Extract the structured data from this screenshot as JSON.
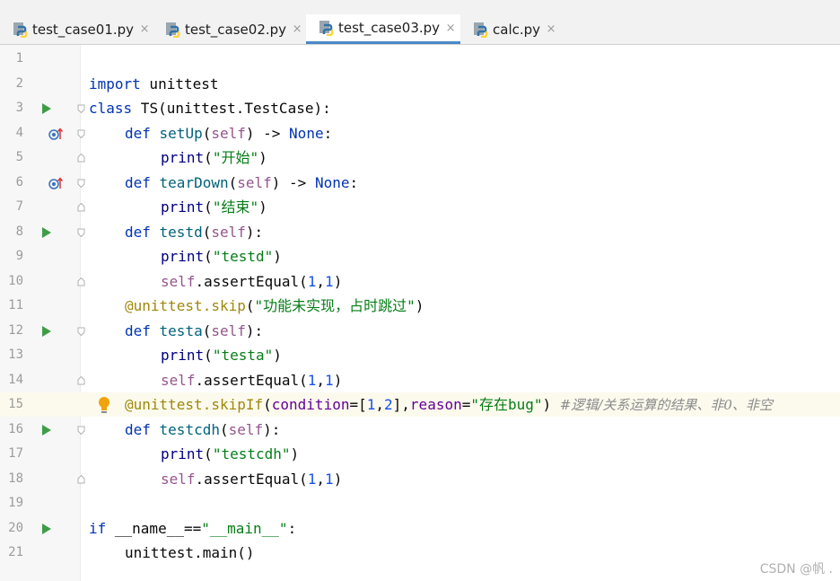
{
  "tabs": [
    {
      "label": "test_case01.py",
      "active": false,
      "icon": "python-file-icon"
    },
    {
      "label": "test_case02.py",
      "active": false,
      "icon": "python-file-icon"
    },
    {
      "label": "test_case03.py",
      "active": true,
      "icon": "python-file-icon"
    },
    {
      "label": "calc.py",
      "active": false,
      "icon": "python-file-icon"
    }
  ],
  "close_glyph": "×",
  "line_numbers": [
    "1",
    "2",
    "3",
    "4",
    "5",
    "6",
    "7",
    "8",
    "9",
    "10",
    "11",
    "12",
    "13",
    "14",
    "15",
    "16",
    "17",
    "18",
    "19",
    "20",
    "21"
  ],
  "code": {
    "l2": {
      "kw": "import",
      "rest": " unittest"
    },
    "l3": {
      "kw": "class",
      "rest": " TS(unittest.TestCase):"
    },
    "l4": {
      "kw": "def",
      "name": " setUp",
      "open": "(",
      "self": "self",
      "mid": ") -> ",
      "none": "None",
      "end": ":"
    },
    "l5": {
      "fn": "print",
      "open": "(",
      "str": "\"开始\"",
      "close": ")"
    },
    "l6": {
      "kw": "def",
      "name": " tearDown",
      "open": "(",
      "self": "self",
      "mid": ") -> ",
      "none": "None",
      "end": ":"
    },
    "l7": {
      "fn": "print",
      "open": "(",
      "str": "\"结束\"",
      "close": ")"
    },
    "l8": {
      "kw": "def",
      "name": " testd",
      "open": "(",
      "self": "self",
      "end": "):"
    },
    "l9": {
      "fn": "print",
      "open": "(",
      "str": "\"testd\"",
      "close": ")"
    },
    "l10": {
      "self": "self",
      "call": ".assertEqual(",
      "n1": "1",
      "comma": ",",
      "n2": "1",
      "close": ")"
    },
    "l11": {
      "deco": "@unittest.skip",
      "open": "(",
      "str": "\"功能未实现，占时跳过\"",
      "close": ")"
    },
    "l12": {
      "kw": "def",
      "name": " testa",
      "open": "(",
      "self": "self",
      "end": "):"
    },
    "l13": {
      "fn": "print",
      "open": "(",
      "str": "\"testa\"",
      "close": ")"
    },
    "l14": {
      "self": "self",
      "call": ".assertEqual(",
      "n1": "1",
      "comma": ",",
      "n2": "1",
      "close": ")"
    },
    "l15": {
      "deco": "@unittest.skipIf",
      "open": "(",
      "p1": "condition",
      "eq1": "=[",
      "n1": "1",
      "c": ",",
      "n2": "2",
      "mid": "],",
      "p2": "reason",
      "eq2": "=",
      "str": "\"存在bug\"",
      "close": ")",
      "comment": "  #逻辑/关系运算的结果、非0、非空"
    },
    "l16": {
      "kw": "def",
      "name": " testcdh",
      "open": "(",
      "self": "self",
      "end": "):"
    },
    "l17": {
      "fn": "print",
      "open": "(",
      "str": "\"testcdh\"",
      "close": ")"
    },
    "l18": {
      "self": "self",
      "call": ".assertEqual(",
      "n1": "1",
      "comma": ",",
      "n2": "1",
      "close": ")"
    },
    "l20": {
      "kw": "if",
      "mid": " __name__==",
      "str": "\"__main__\"",
      "end": ":"
    },
    "l21": {
      "rest": "unittest.main()"
    }
  },
  "watermark": "CSDN @帆 .",
  "colors": {
    "keyword": "#0033b3",
    "string": "#067d17",
    "number": "#1750eb",
    "self": "#94558d",
    "decorator": "#9e880d",
    "param": "#660099",
    "comment": "#8c8c8c",
    "run": "#3e9e48",
    "tab_active": "#4a88c7"
  }
}
